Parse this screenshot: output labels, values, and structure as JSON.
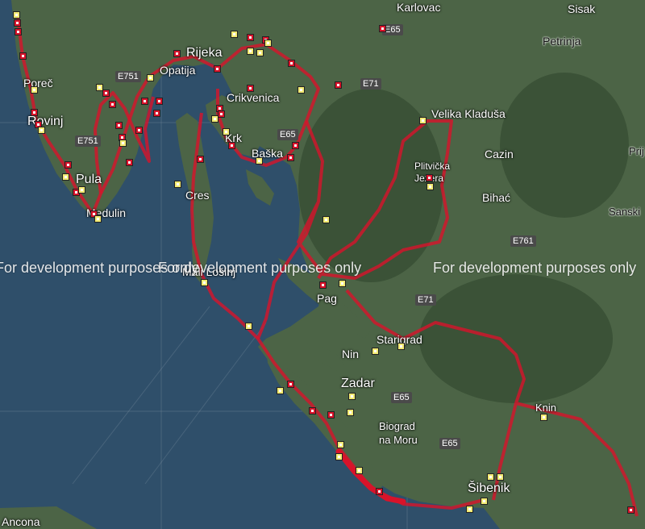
{
  "map": {
    "watermark": "For development purposes only",
    "colors": {
      "sea": "#2f4f6a",
      "land": "#4c6446",
      "route": "#d8132a",
      "marker_red": "#d8132a",
      "marker_yellow": "#f2ea73"
    },
    "places": {
      "karlovac": "Karlovac",
      "sisak": "Sisak",
      "petrinja": "Petrinja",
      "rijeka": "Rijeka",
      "opatija": "Opatija",
      "porec": "Poreč",
      "rovinj": "Rovinj",
      "pula": "Pula",
      "medulin": "Medulin",
      "crikvenica": "Crikvenica",
      "krk": "Krk",
      "baska": "Baška",
      "cres": "Cres",
      "mali_losinj": "Mali Lošinj",
      "velika_kladusa": "Velika Kladuša",
      "cazin": "Cazin",
      "plitvicka_jezera": "Plitvička Jezera",
      "bihac": "Bihać",
      "sanski": "Sanski",
      "prij": "Prij",
      "pag": "Pag",
      "starigrad": "Starigrad",
      "nin": "Nin",
      "zadar": "Zadar",
      "biograd": "Biograd\nna Moru",
      "knin": "Knin",
      "sibenik": "Šibenik",
      "ancona": "Ancona"
    },
    "roads": {
      "e65_top": "E65",
      "e751_a": "E751",
      "e71_a": "E71",
      "e751_b": "E751",
      "e65_b": "E65",
      "e761": "E761",
      "e71_b": "E71",
      "e65_c": "E65",
      "e65_d": "E65"
    }
  }
}
